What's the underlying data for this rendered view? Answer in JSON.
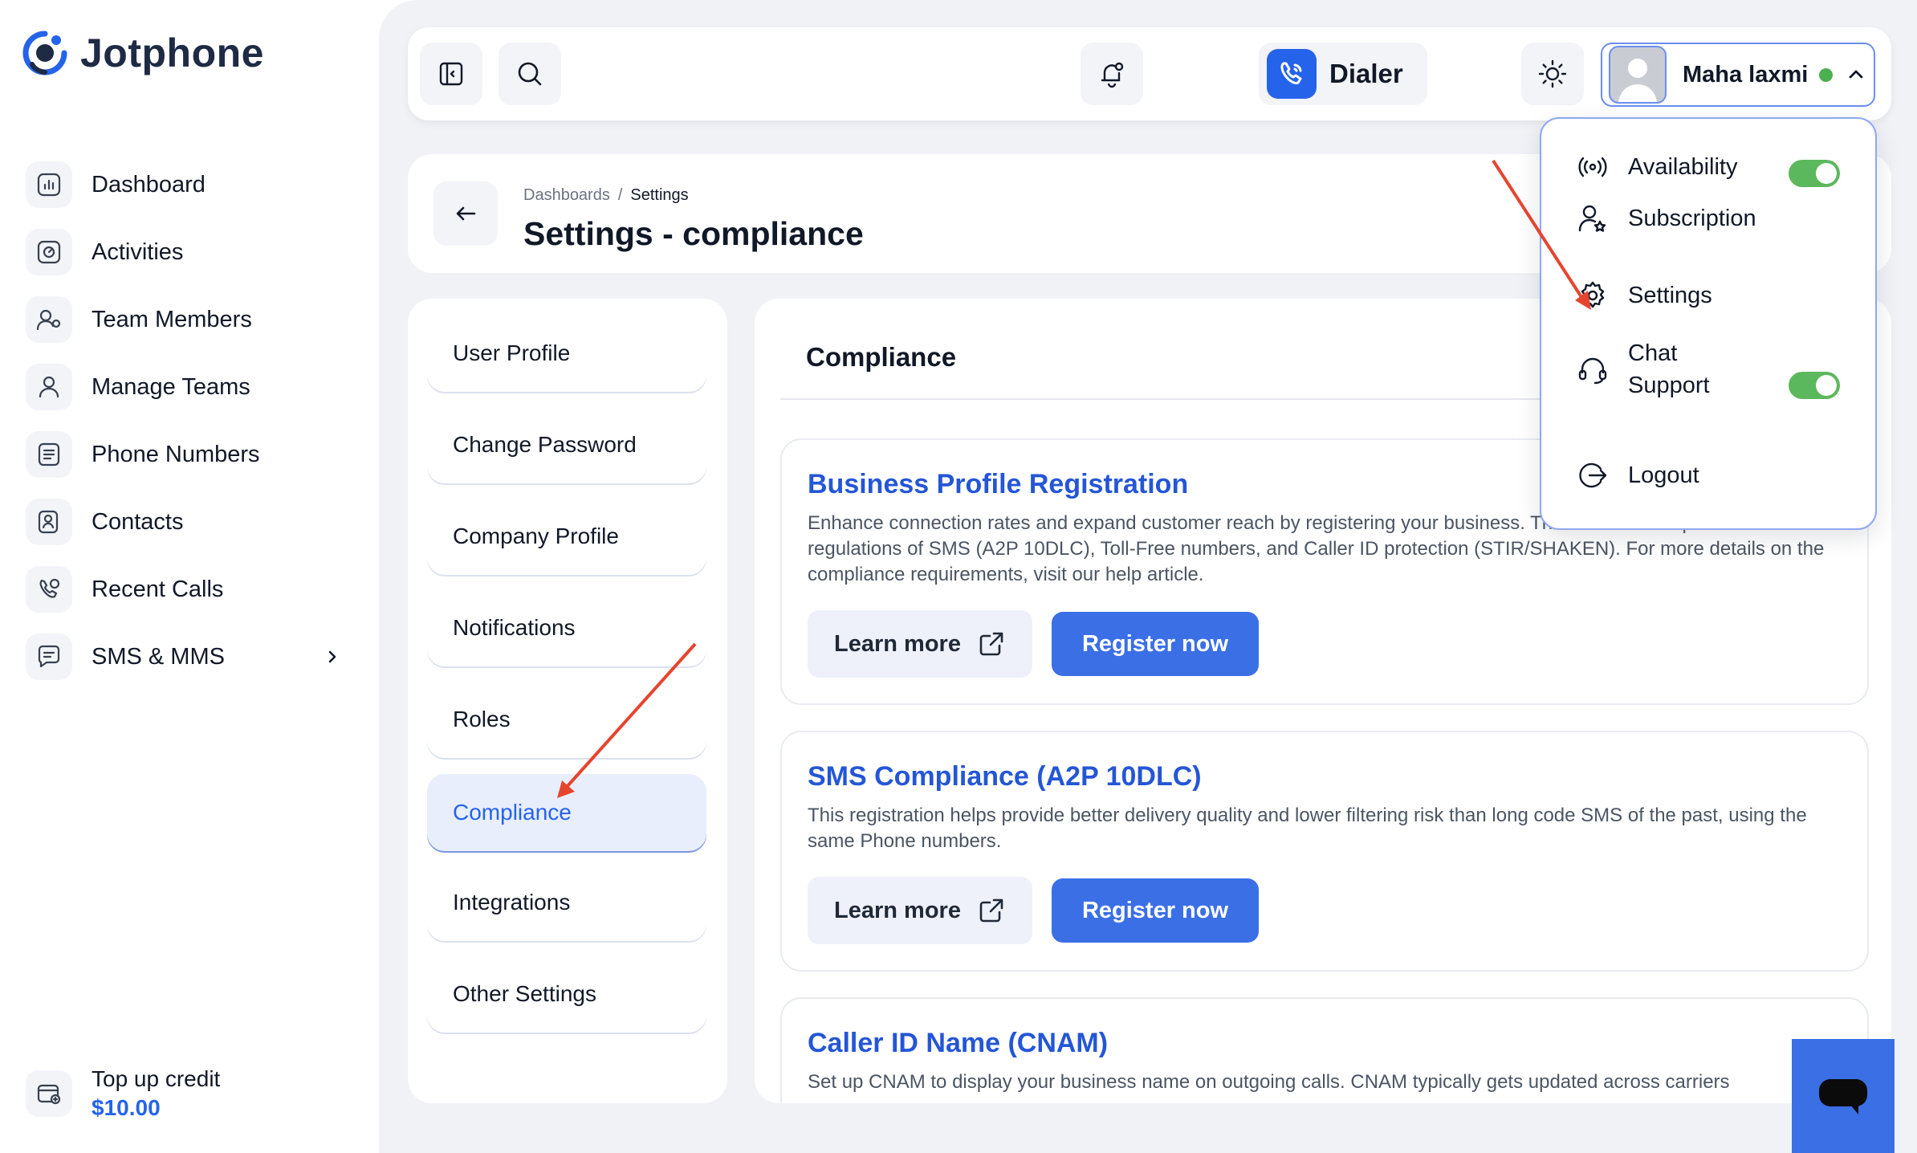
{
  "brand": {
    "name": "Jotphone"
  },
  "sidebar": {
    "items": [
      {
        "label": "Dashboard",
        "icon": "chart-icon"
      },
      {
        "label": "Activities",
        "icon": "activity-icon"
      },
      {
        "label": "Team Members",
        "icon": "user-settings-icon"
      },
      {
        "label": "Manage Teams",
        "icon": "users-icon"
      },
      {
        "label": "Phone Numbers",
        "icon": "list-icon"
      },
      {
        "label": "Contacts",
        "icon": "contact-icon"
      },
      {
        "label": "Recent Calls",
        "icon": "phone-history-icon"
      },
      {
        "label": "SMS & MMS",
        "icon": "message-icon",
        "has_submenu": true
      }
    ],
    "topup": {
      "label": "Top up credit",
      "amount": "$10.00"
    }
  },
  "topbar": {
    "dialer_label": "Dialer",
    "user": {
      "name": "Maha laxmi",
      "status": "online"
    }
  },
  "header": {
    "breadcrumb": [
      "Dashboards",
      "/",
      "Settings"
    ],
    "title": "Settings - compliance"
  },
  "settings_menu": {
    "items": [
      "User Profile",
      "Change Password",
      "Company Profile",
      "Notifications",
      "Roles",
      "Compliance",
      "Integrations",
      "Other Settings"
    ],
    "active": "Compliance"
  },
  "content": {
    "title": "Compliance",
    "sections": [
      {
        "title": "Business Profile Registration",
        "description": "Enhance connection rates and expand customer reach by registering your business. This ensures compliance with regulations of SMS (A2P 10DLC), Toll-Free numbers, and Caller ID protection (STIR/SHAKEN). For more details on the compliance requirements, visit our help article.",
        "learn_label": "Learn more",
        "register_label": "Register now"
      },
      {
        "title": "SMS Compliance (A2P 10DLC)",
        "description": "This registration helps provide better delivery quality and lower filtering risk than long code SMS of the past, using the same Phone numbers.",
        "learn_label": "Learn more",
        "register_label": "Register now"
      },
      {
        "title": "Caller ID Name (CNAM)",
        "description": "Set up CNAM to display your business name on outgoing calls. CNAM typically gets updated across carriers"
      }
    ]
  },
  "user_menu": {
    "items": [
      {
        "label": "Availability",
        "icon": "broadcast-icon",
        "toggle": true
      },
      {
        "label": "Subscription",
        "icon": "user-star-icon"
      },
      {
        "label": "Settings",
        "icon": "gear-icon"
      },
      {
        "label": "Chat Support",
        "icon": "headset-icon",
        "toggle": true
      },
      {
        "label": "Logout",
        "icon": "logout-icon"
      }
    ]
  },
  "colors": {
    "accent": "#2563eb",
    "toggle_on": "#5cb85c",
    "online": "#4caf50",
    "annotation_arrow": "#e5452f"
  }
}
